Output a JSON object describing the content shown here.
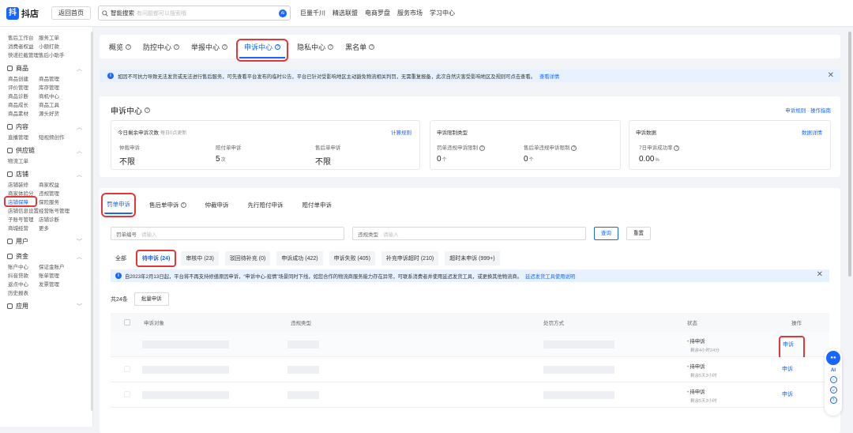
{
  "header": {
    "logo_text": "抖店",
    "logo_glyph": "抖",
    "back_label": "返回首页",
    "search_label": "智能搜索",
    "search_placeholder": "有问题都可以搜索哦",
    "ai_badge": "AI",
    "nav": [
      "巨量千川",
      "精选联盟",
      "电商罗盘",
      "服务市场",
      "学习中心"
    ]
  },
  "sidebar": {
    "top_rows": [
      [
        "售后工作台",
        "服务工单"
      ],
      [
        "消费者权益",
        "小额打款"
      ],
      [
        "快递拦截管理",
        "售后小助手"
      ]
    ],
    "sections": [
      {
        "title": "商品",
        "rows": [
          [
            "商品创建",
            "商品管理"
          ],
          [
            "评价管理",
            "库存管理"
          ],
          [
            "商品诊断",
            "商机中心"
          ],
          [
            "商品成长",
            "商品工具"
          ],
          [
            "商品素材",
            "源头好货"
          ]
        ]
      },
      {
        "title": "内容",
        "rows": [
          [
            "直播管理",
            "短视频创作"
          ]
        ]
      },
      {
        "title": "供应链",
        "rows": [
          [
            "物流工单",
            ""
          ]
        ]
      },
      {
        "title": "店铺",
        "rows": [
          [
            "店铺装修",
            "商家权益"
          ],
          [
            "商家体验分",
            "违规管理"
          ],
          [
            "店铺保障",
            "保险服务"
          ],
          [
            "店铺信息设置",
            "经营账号管理"
          ],
          [
            "子账号管理",
            "店铺诊断"
          ],
          [
            "商城经营",
            "更多"
          ]
        ]
      },
      {
        "title": "用户",
        "rows": []
      },
      {
        "title": "资金",
        "rows": [
          [
            "账户中心",
            "保证金账户"
          ],
          [
            "抖音贷款",
            "账单管理"
          ],
          [
            "返点中心",
            "发票管理"
          ],
          [
            "历史报表",
            ""
          ]
        ]
      },
      {
        "title": "应用",
        "rows": []
      }
    ],
    "active_item": "店铺保障"
  },
  "top_tabs": [
    {
      "label": "概览",
      "active": false
    },
    {
      "label": "防控中心",
      "active": false
    },
    {
      "label": "举报中心",
      "active": false
    },
    {
      "label": "申诉中心",
      "active": true
    },
    {
      "label": "隐私中心",
      "active": false
    },
    {
      "label": "黑名单",
      "active": false
    }
  ],
  "notice_top": {
    "text": "如因不可抗力导致无法发货或无法进行售后服务，可先查看平台发布的临时公告，平台已针对受影响地区主动豁免物流相关判罚，无需重复报备，此次自然灾害受影响地区及规则可点击查看。",
    "link": "查看详情"
  },
  "complaint_center": {
    "title": "申诉中心",
    "rules_link": "申诉规则 · 操作指南",
    "box1": {
      "title": "今日剩余申诉次数",
      "subtitle": "每日0点更新",
      "link": "计算规则",
      "items": [
        {
          "label": "仲裁申诉",
          "value": "不限",
          "unit": ""
        },
        {
          "label": "赔付单申诉",
          "value": "5",
          "unit": "次"
        },
        {
          "label": "售后单申诉",
          "value": "不限",
          "unit": ""
        }
      ]
    },
    "box2": {
      "title": "申诉限制类型",
      "items": [
        {
          "label": "罚单违规申诉限制",
          "value": "0",
          "unit": "个"
        },
        {
          "label": "售后单违规申诉限制",
          "value": "0",
          "unit": "个"
        }
      ]
    },
    "box3": {
      "title": "申诉数据",
      "link": "数据详情",
      "items": [
        {
          "label": "7日申诉成功率",
          "value": "0.00",
          "unit": "%"
        }
      ]
    }
  },
  "list": {
    "tabs": [
      {
        "label": "罚单申诉",
        "active": true
      },
      {
        "label": "售后单申诉",
        "active": false
      },
      {
        "label": "仲裁申诉",
        "active": false
      },
      {
        "label": "先行赔付申诉",
        "active": false
      },
      {
        "label": "赔付单申诉",
        "active": false
      }
    ],
    "filter1_label": "罚单编号",
    "filter1_placeholder": "请输入",
    "filter2_label": "违规类型",
    "filter2_placeholder": "请输入",
    "query_button": "查询",
    "reset_button": "重置",
    "status_tabs": [
      "全部",
      "待申诉 (24)",
      "审核中 (23)",
      "驳回待补充 (0)",
      "申诉成功 (422)",
      "申诉失败 (405)",
      "补充申诉超时 (210)",
      "超时未申诉 (999+)"
    ],
    "active_status": 1,
    "notice": {
      "text": "自2023年2月13日起，平台将不再支持修缮原因申诉，“申诉中心-疫情”场景同时下线，如您合作的物流商服务能力存在异常，可联系消费者并使用延迟发货工具，或更换其他物流商。",
      "link": "延迟发货工具使用说明"
    },
    "count_text": "共24条",
    "batch_button": "批量申诉",
    "columns": [
      "申诉对象",
      "违规类型",
      "处罚方式",
      "状态",
      "操作"
    ],
    "rows": [
      {
        "status": "待申诉",
        "sub": "剩余4小时24分",
        "action": "申诉"
      },
      {
        "status": "待申诉",
        "sub": "剩余5天3小时",
        "action": "申诉"
      },
      {
        "status": "待申诉",
        "sub": "剩余5天3小时",
        "action": "申诉"
      }
    ]
  },
  "float_panel": {
    "ai_label": "AI"
  },
  "colors": {
    "accent": "#1966ff",
    "highlight": "#e5373a",
    "pending": "#ff8a00"
  }
}
